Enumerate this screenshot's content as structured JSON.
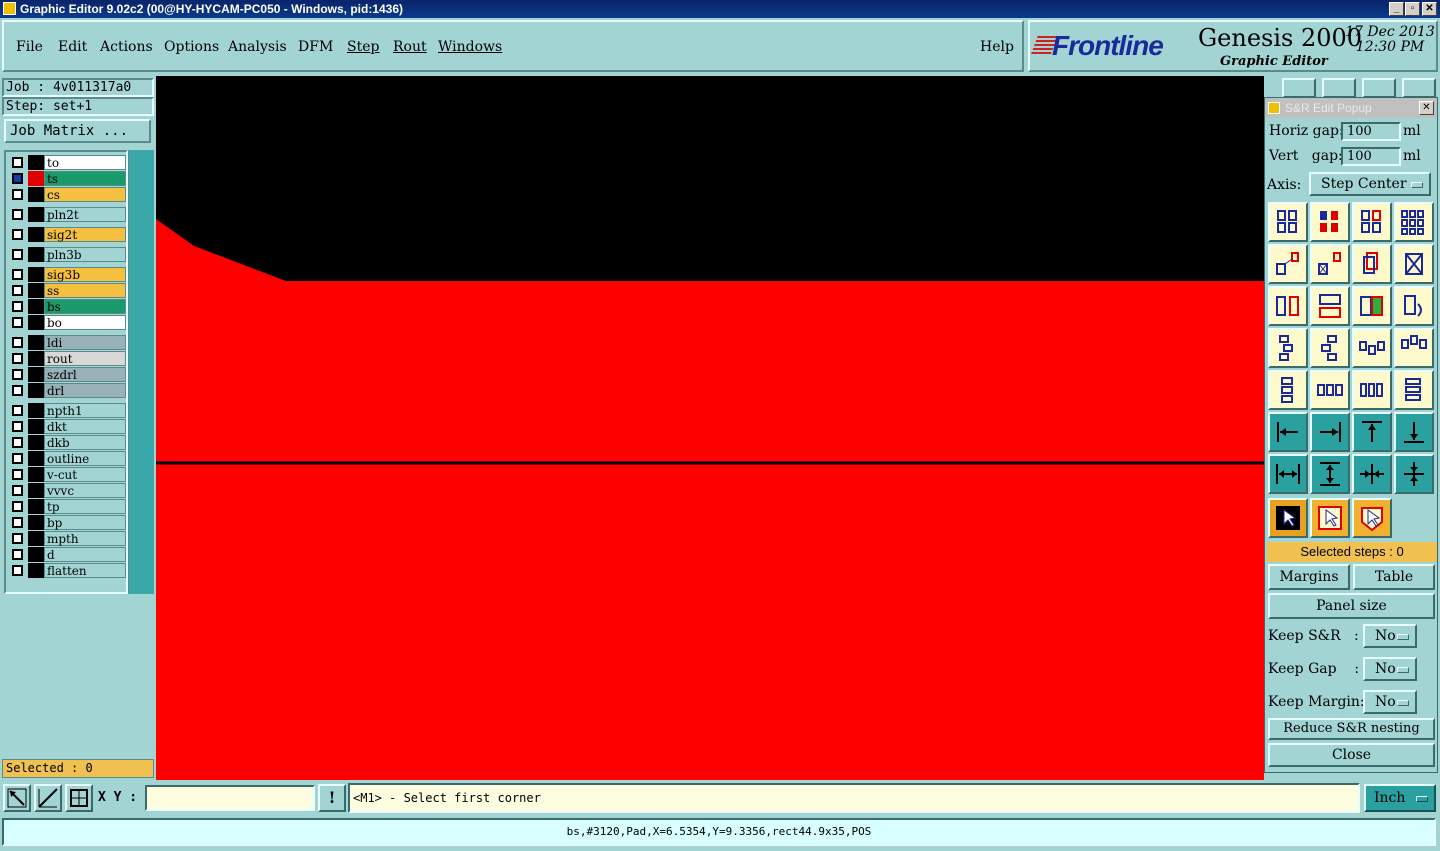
{
  "window": {
    "title": "Graphic Editor 9.02c2 (00@HY-HYCAM-PC050 - Windows, pid:1436)",
    "minimize": "_",
    "maximize": "▫",
    "close": "✕"
  },
  "menu": {
    "file": "File",
    "edit": "Edit",
    "actions": "Actions",
    "options": "Options",
    "analysis": "Analysis",
    "dfm": "DFM",
    "step": "Step",
    "rout": "Rout",
    "windows": "Windows",
    "help": "Help"
  },
  "logo": {
    "brand": "Frontline",
    "product": "Genesis 2000",
    "subtitle": "Graphic Editor",
    "date": "17 Dec 2013",
    "time": "12:30 PM"
  },
  "job": {
    "job_label": "Job : 4v011317a0",
    "step_label": "Step: set+1",
    "matrix_button": "Job Matrix ..."
  },
  "layers": [
    {
      "name": "to",
      "color": "#ffffff",
      "checked": false,
      "active": false
    },
    {
      "name": "ts",
      "color": "#1a9a6a",
      "checked": true,
      "active": true
    },
    {
      "name": "cs",
      "color": "#f5c040",
      "checked": false,
      "active": false
    },
    {
      "name": "pln2t",
      "color": "#a3d4d4",
      "checked": false,
      "active": false
    },
    {
      "name": "sig2t",
      "color": "#f5c040",
      "checked": false,
      "active": false
    },
    {
      "name": "pln3b",
      "color": "#a3d4d4",
      "checked": false,
      "active": false
    },
    {
      "name": "sig3b",
      "color": "#f5c040",
      "checked": false,
      "active": false
    },
    {
      "name": "ss",
      "color": "#f5c040",
      "checked": false,
      "active": false
    },
    {
      "name": "bs",
      "color": "#1a9a6a",
      "checked": false,
      "active": false
    },
    {
      "name": "bo",
      "color": "#ffffff",
      "checked": false,
      "active": false
    },
    {
      "name": "ldi",
      "color": "#98b0b8",
      "checked": false,
      "active": false
    },
    {
      "name": "rout",
      "color": "#d8d8d8",
      "checked": false,
      "active": false
    },
    {
      "name": "szdrl",
      "color": "#98b0b8",
      "checked": false,
      "active": false
    },
    {
      "name": "drl",
      "color": "#98b0b8",
      "checked": false,
      "active": false
    },
    {
      "name": "npth1",
      "color": "#a3d4d4",
      "checked": false,
      "active": false
    },
    {
      "name": "dkt",
      "color": "#a3d4d4",
      "checked": false,
      "active": false
    },
    {
      "name": "dkb",
      "color": "#a3d4d4",
      "checked": false,
      "active": false
    },
    {
      "name": "outline",
      "color": "#a3d4d4",
      "checked": false,
      "active": false
    },
    {
      "name": "v-cut",
      "color": "#a3d4d4",
      "checked": false,
      "active": false
    },
    {
      "name": "vvvc",
      "color": "#a3d4d4",
      "checked": false,
      "active": false
    },
    {
      "name": "tp",
      "color": "#a3d4d4",
      "checked": false,
      "active": false
    },
    {
      "name": "bp",
      "color": "#a3d4d4",
      "checked": false,
      "active": false
    },
    {
      "name": "mpth",
      "color": "#a3d4d4",
      "checked": false,
      "active": false
    },
    {
      "name": "d",
      "color": "#a3d4d4",
      "checked": false,
      "active": false
    },
    {
      "name": "flatten",
      "color": "#a3d4d4",
      "checked": false,
      "active": false
    }
  ],
  "selected_label": "Selected : 0",
  "popup": {
    "title": "S&R Edit Popup",
    "horiz_label": "Horiz gap:",
    "horiz_value": "100",
    "horiz_unit": "ml",
    "vert_label": "Vert   gap:",
    "vert_value": "100",
    "vert_unit": "ml",
    "axis_label": "Axis:",
    "axis_value": "Step Center",
    "selected_steps": "Selected steps : 0",
    "margins": "Margins",
    "table": "Table",
    "panel_size": "Panel size",
    "keep_sr_label": "Keep S&R   :",
    "keep_sr_value": "No",
    "keep_gap_label": "Keep Gap    :",
    "keep_gap_value": "No",
    "keep_margin_label": "Keep Margin:",
    "keep_margin_value": "No",
    "reduce": "Reduce S&R nesting",
    "close": "Close"
  },
  "bottom": {
    "xy_label": "X Y :",
    "xy_value": "",
    "info_icon": "!",
    "prompt": "<M1> - Select first corner",
    "unit": "Inch",
    "status": "bs,#3120,Pad,X=6.5354,Y=9.3356,rect44.9x35,POS"
  },
  "colors": {
    "background": "#a3d4d4",
    "canvas": "#000000",
    "copper": "#ff0000",
    "accent_teal": "#2aa0a0",
    "highlight_yellow": "#f0c050"
  }
}
